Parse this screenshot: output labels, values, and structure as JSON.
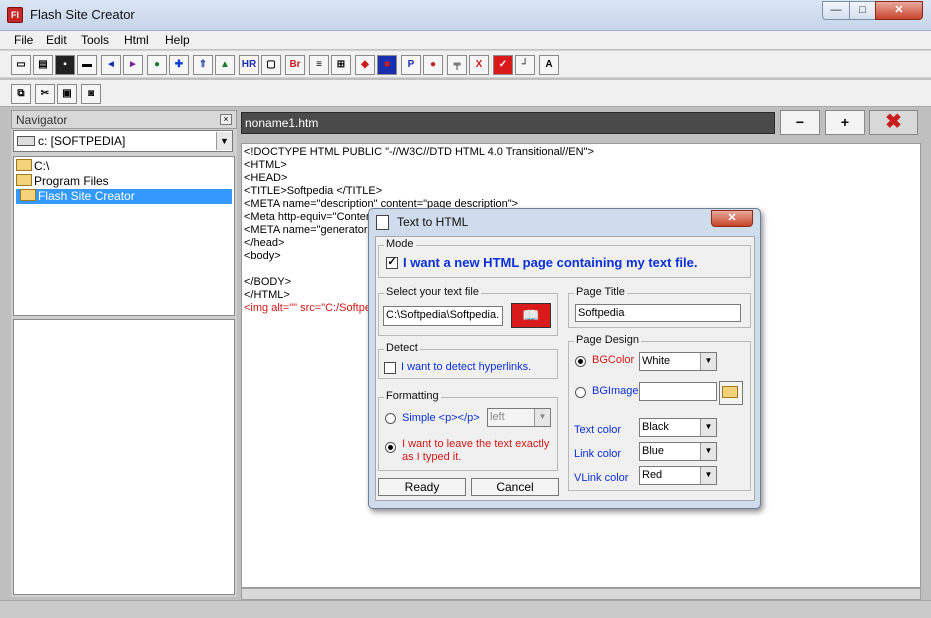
{
  "window": {
    "title": "Flash Site Creator",
    "min": "—",
    "max": "□",
    "close": "✕"
  },
  "menu": [
    "File",
    "Edit",
    "Tools",
    "Html",
    "Help"
  ],
  "toolbar": {
    "hr": "HR",
    "br": "Br",
    "p": "P",
    "x": "X",
    "a": "A"
  },
  "navigator": {
    "title": "Navigator",
    "close": "×",
    "drive": "c: [SOFTPEDIA]",
    "folders": [
      "C:\\",
      "Program Files",
      "Flash Site Creator"
    ]
  },
  "editor": {
    "filename": "noname1.htm",
    "zoom_out": "−",
    "zoom_in": "+",
    "close_doc": "✖",
    "lines": [
      "<!DOCTYPE HTML PUBLIC \"-//W3C//DTD HTML 4.0 Transitional//EN\">",
      "<HTML>",
      "<HEAD>",
      "<TITLE>Softpedia </TITLE>",
      "<META name=\"description\" content=\"page description\">",
      "<Meta http-equiv=\"Content",
      "<META name=\"generator",
      "</head>",
      "<body>",
      "",
      "</BODY>",
      "</HTML>",
      "<img alt=\"\" src=\"C:/Softpe"
    ]
  },
  "dialog": {
    "title": "Text to HTML",
    "close": "✕",
    "mode_label": "Mode",
    "mode_option": "I want a new HTML page containing my text file.",
    "select_label": "Select your text file",
    "file_path": "C:\\Softpedia\\Softpedia.",
    "detect_label": "Detect",
    "detect_option": "I want to detect hyperlinks.",
    "formatting_label": "Formatting",
    "simple_option": "Simple <p></p>",
    "simple_select": "left",
    "leave_option_1": "I want to leave the text exactly",
    "leave_option_2": "as I typed it.",
    "page_title_label": "Page Title",
    "page_title_value": "Softpedia",
    "page_design_label": "Page Design",
    "bgcolor_label": "BGColor",
    "bgcolor_value": "White",
    "bgimage_label": "BGImage",
    "text_color_label": "Text color",
    "text_color_value": "Black",
    "link_color_label": "Link color",
    "link_color_value": "Blue",
    "vlink_color_label": "VLink color",
    "vlink_color_value": "Red",
    "ready": "Ready",
    "cancel": "Cancel"
  },
  "colors": {
    "accent_blue": "#0b2fd6",
    "accent_red": "#d01818",
    "selection": "#3399ff"
  }
}
